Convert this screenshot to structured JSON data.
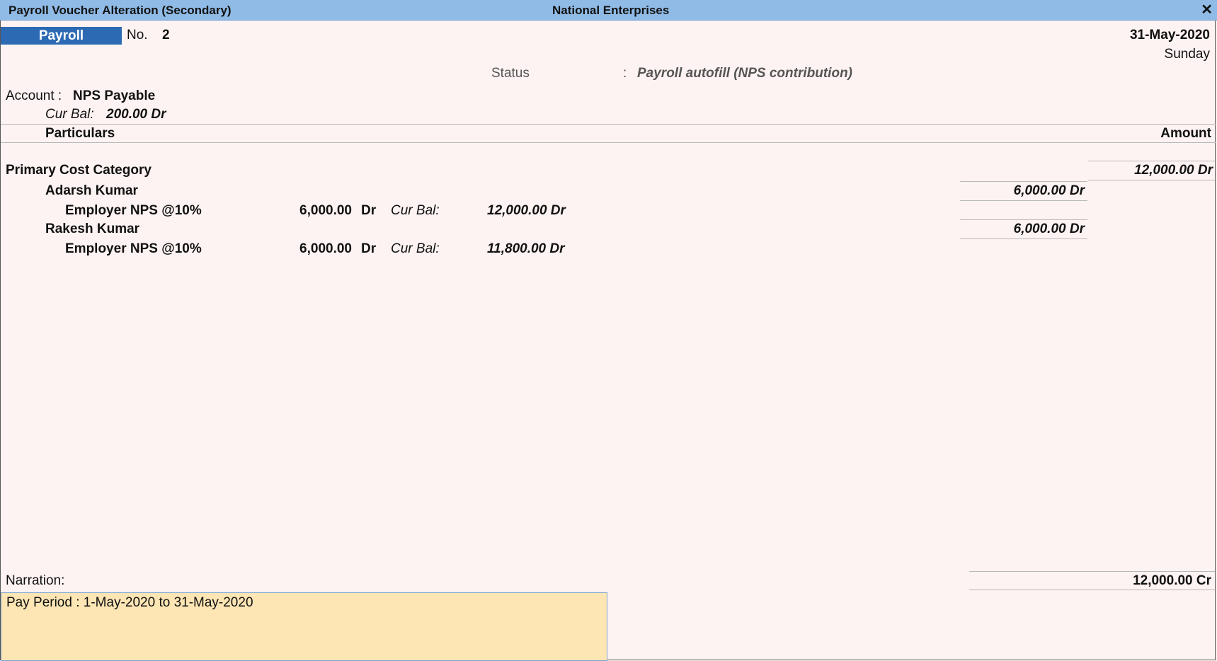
{
  "window": {
    "title": "Payroll Voucher Alteration (Secondary)",
    "company": "National Enterprises",
    "close_glyph": "✕"
  },
  "voucher": {
    "type": "Payroll",
    "no_label": "No.",
    "no_value": "2",
    "date": "31-May-2020",
    "day": "Sunday",
    "status_label": "Status",
    "status_sep": ":",
    "status_value": "Payroll autofill (NPS contribution)"
  },
  "account": {
    "label": "Account :",
    "name": "NPS Payable",
    "cur_bal_label": "Cur Bal:",
    "cur_bal_value": "200.00 Dr"
  },
  "table": {
    "col_particulars": "Particulars",
    "col_amount": "Amount",
    "category": {
      "name": "Primary Cost Category",
      "amount": "12,000.00 Dr"
    },
    "employees": [
      {
        "name": "Adarsh Kumar",
        "amount": "6,000.00 Dr",
        "pay_head": "Employer NPS @10%",
        "pay_amount": "6,000.00",
        "pay_drcr": "Dr",
        "cur_bal_label": "Cur Bal:",
        "cur_bal_value": "12,000.00 Dr"
      },
      {
        "name": "Rakesh Kumar",
        "amount": "6,000.00 Dr",
        "pay_head": "Employer NPS @10%",
        "pay_amount": "6,000.00",
        "pay_drcr": "Dr",
        "cur_bal_label": "Cur Bal:",
        "cur_bal_value": "11,800.00 Dr"
      }
    ]
  },
  "narration": {
    "label": "Narration:",
    "text": "Pay Period : 1-May-2020 to 31-May-2020",
    "total": "12,000.00 Cr"
  }
}
